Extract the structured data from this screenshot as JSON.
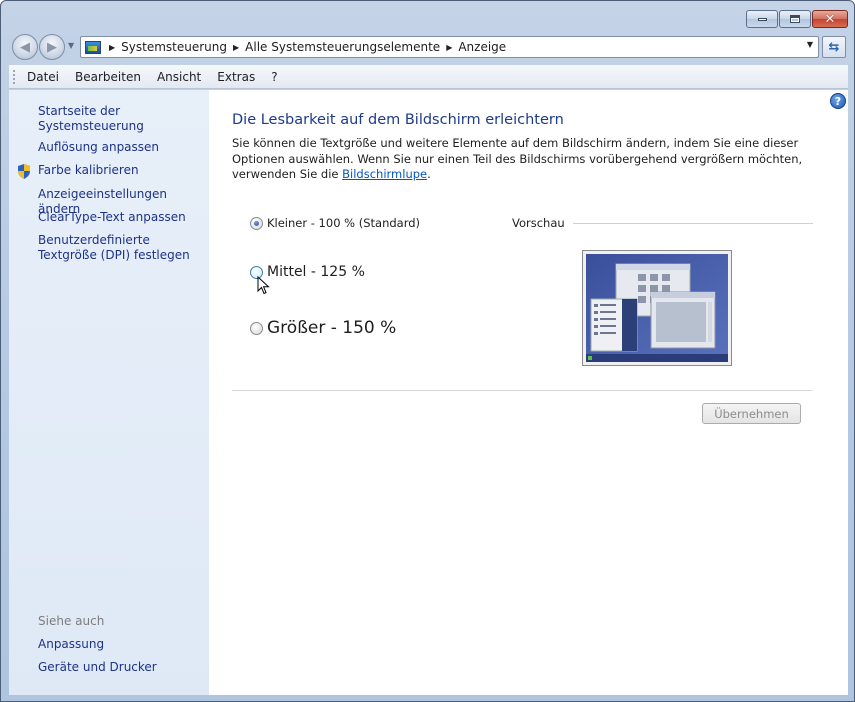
{
  "window": {
    "title": "Anzeige"
  },
  "breadcrumb": [
    "Systemsteuerung",
    "Alle Systemsteuerungselemente",
    "Anzeige"
  ],
  "menu": [
    "Datei",
    "Bearbeiten",
    "Ansicht",
    "Extras",
    "?"
  ],
  "sidebar": {
    "home": "Startseite der Systemsteuerung",
    "links": [
      "Auflösung anpassen",
      "Farbe kalibrieren",
      "Anzeigeeinstellungen ändern",
      "ClearType-Text anpassen",
      "Benutzerdefinierte Textgröße (DPI) festlegen"
    ],
    "see_also_label": "Siehe auch",
    "see_also": [
      "Anpassung",
      "Geräte und Drucker"
    ]
  },
  "main": {
    "title": "Die Lesbarkeit auf dem Bildschirm erleichtern",
    "description": "Sie können die Textgröße und weitere Elemente auf dem Bildschirm ändern, indem Sie eine dieser Optionen auswählen. Wenn Sie nur einen Teil des Bildschirms vorübergehend vergrößern möchten, verwenden Sie die",
    "description_link": "Bildschirmlupe",
    "options": [
      {
        "label": "Kleiner - 100 % (Standard)",
        "selected": true
      },
      {
        "label": "Mittel - 125 %",
        "selected": false
      },
      {
        "label": "Größer - 150 %",
        "selected": false
      }
    ],
    "preview_label": "Vorschau",
    "apply_button": "Übernehmen"
  },
  "colors": {
    "accent_title": "#1e3a8a",
    "link": "#1e3287",
    "sidebar_bg": "#e3ecf7"
  }
}
